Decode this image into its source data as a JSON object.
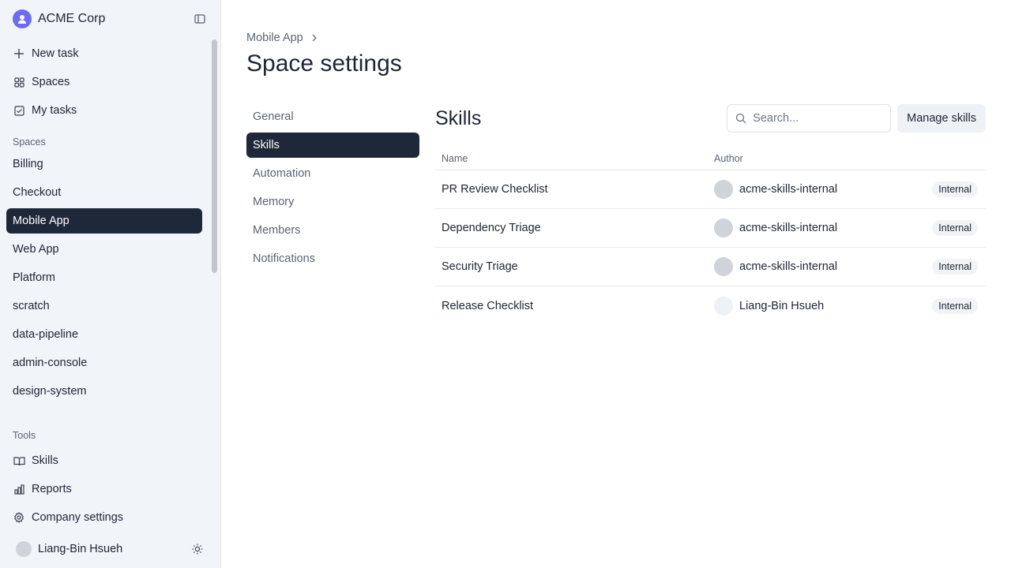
{
  "org": {
    "name": "ACME Corp"
  },
  "sidebar": {
    "top_items": [
      {
        "label": "New task",
        "icon": "plus-icon"
      },
      {
        "label": "Spaces",
        "icon": "grid-icon"
      },
      {
        "label": "My tasks",
        "icon": "checkbox-icon"
      }
    ],
    "spaces_label": "Spaces",
    "spaces": [
      "Billing",
      "Checkout",
      "Mobile App",
      "Web App",
      "Platform",
      "scratch",
      "data-pipeline",
      "admin-console",
      "design-system"
    ],
    "active_space": "Mobile App",
    "tools_label": "Tools",
    "tools": [
      {
        "label": "Skills",
        "icon": "book-icon"
      },
      {
        "label": "Reports",
        "icon": "bar-chart-icon"
      },
      {
        "label": "Company settings",
        "icon": "gear-icon"
      }
    ],
    "user": {
      "name": "Liang-Bin Hsueh"
    }
  },
  "breadcrumb": {
    "parent": "Mobile App"
  },
  "page": {
    "title": "Space settings"
  },
  "settings_nav": {
    "items": [
      "General",
      "Skills",
      "Automation",
      "Memory",
      "Members",
      "Notifications"
    ],
    "active": "Skills"
  },
  "skills": {
    "title": "Skills",
    "search_placeholder": "Search...",
    "manage_label": "Manage skills",
    "columns": {
      "name": "Name",
      "author": "Author"
    },
    "rows": [
      {
        "name": "PR Review Checklist",
        "author": "acme-skills-internal",
        "badge": "Internal"
      },
      {
        "name": "Dependency Triage",
        "author": "acme-skills-internal",
        "badge": "Internal"
      },
      {
        "name": "Security Triage",
        "author": "acme-skills-internal",
        "badge": "Internal"
      },
      {
        "name": "Release Checklist",
        "author": "Liang-Bin Hsueh",
        "badge": "Internal"
      }
    ]
  },
  "colors": {
    "active_bg": "#1f2839",
    "sidebar_bg": "#f1f4f9",
    "logo": "#6d6cf0"
  }
}
